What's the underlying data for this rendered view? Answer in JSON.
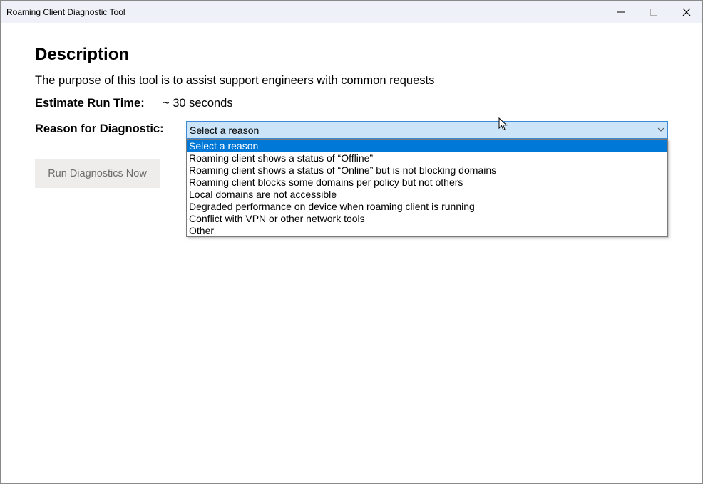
{
  "window": {
    "title": "Roaming Client Diagnostic Tool",
    "controls": {
      "minimize_icon": "minimize-icon",
      "maximize_icon": "maximize-icon",
      "close_icon": "close-icon"
    }
  },
  "main": {
    "heading": "Description",
    "description": "The purpose of this tool is to assist support engineers with common requests",
    "runtime_label": "Estimate Run Time:",
    "runtime_value": "~ 30 seconds",
    "reason_label": "Reason for Diagnostic:",
    "reason_select": {
      "value": "Select a reason",
      "options": [
        "Select a reason",
        "Roaming client shows a status of “Offline”",
        "Roaming client shows a status of “Online” but is not blocking domains",
        "Roaming client blocks some domains per policy but not others",
        "Local domains are not accessible",
        "Degraded performance on device when roaming client is running",
        "Conflict with VPN or other network tools",
        "Other"
      ]
    },
    "run_button": "Run Diagnostics Now"
  },
  "colors": {
    "titlebar": "#eef2f8",
    "select_bg": "#cce4f7",
    "select_border": "#3c8ad6",
    "highlight": "#0078d7",
    "button_bg": "#eeedeb",
    "button_text": "#6d6d6d"
  }
}
